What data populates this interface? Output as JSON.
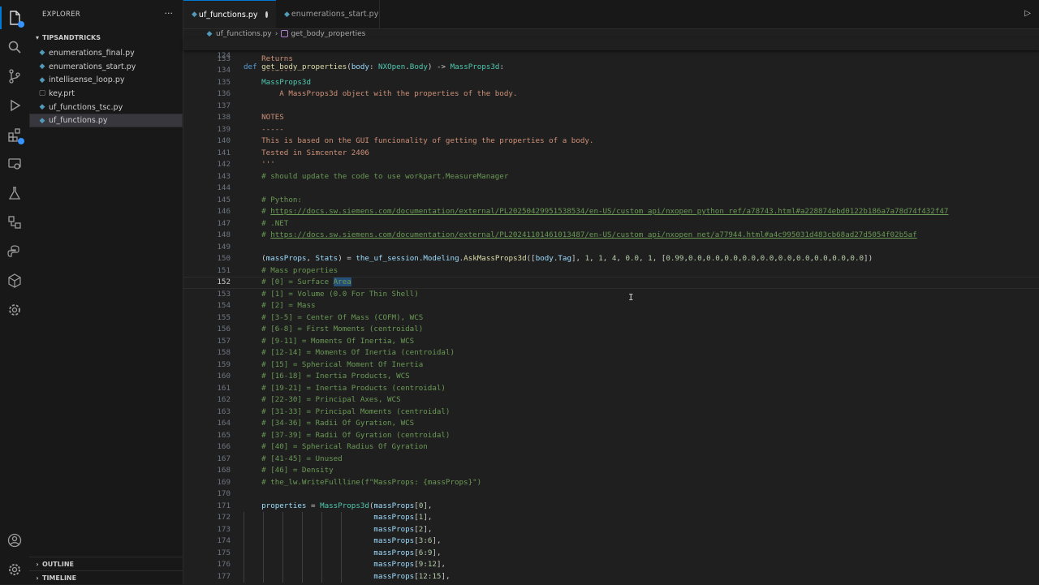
{
  "sidebar": {
    "title": "EXPLORER",
    "more": "···",
    "folder": "TIPSANDTRICKS",
    "files": [
      {
        "name": "enumerations_final.py",
        "type": "py"
      },
      {
        "name": "enumerations_start.py",
        "type": "py"
      },
      {
        "name": "intellisense_loop.py",
        "type": "py"
      },
      {
        "name": "key.prt",
        "type": "other"
      },
      {
        "name": "uf_functions_tsc.py",
        "type": "py"
      },
      {
        "name": "uf_functions.py",
        "type": "py",
        "selected": true
      }
    ],
    "outline": "OUTLINE",
    "timeline": "TIMELINE"
  },
  "tabs": [
    {
      "label": "uf_functions.py",
      "active": true,
      "modified": true
    },
    {
      "label": "enumerations_start.py",
      "active": false
    }
  ],
  "breadcrumb": {
    "file": "uf_functions.py",
    "symbol": "get_body_properties"
  },
  "sticky": {
    "num": "124"
  },
  "lines": [
    {
      "num": "133",
      "text": "    Returns"
    },
    {
      "num": "134",
      "text": "    -------"
    },
    {
      "num": "135",
      "text": "    MassProps3d"
    },
    {
      "num": "136",
      "text": "        A MassProps3d object with the properties of the body."
    },
    {
      "num": "137",
      "text": ""
    },
    {
      "num": "138",
      "text": "    NOTES"
    },
    {
      "num": "139",
      "text": "    -----"
    },
    {
      "num": "140",
      "text": "    This is based on the GUI funcionality of getting the properties of a body."
    },
    {
      "num": "141",
      "text": "    Tested in Simcenter 2406"
    },
    {
      "num": "142",
      "text": "    '''"
    },
    {
      "num": "143",
      "text": "    # should update the code to use workpart.MeasureManager"
    },
    {
      "num": "144",
      "text": ""
    },
    {
      "num": "145",
      "text": "    # Python:"
    },
    {
      "num": "146",
      "text": "    # https://docs.sw.siemens.com/documentation/external/PL20250429951538534/en-US/custom_api/nxopen_python_ref/a78743.html#a228874ebd0122b186a7a78d74f432f47"
    },
    {
      "num": "147",
      "text": "    # .NET"
    },
    {
      "num": "148",
      "text": "    # https://docs.sw.siemens.com/documentation/external/PL20241101461013487/en-US/custom_api/nxopen_net/a77944.html#a4c995031d483cb68ad27d5054f02b5af"
    },
    {
      "num": "149",
      "text": ""
    },
    {
      "num": "150",
      "text": "    (massProps, Stats) = the_uf_session.Modeling.AskMassProps3d([body.Tag], 1, 1, 4, 0.0, 1, [0.99,0.0,0.0,0.0,0.0,0.0,0.0,0.0,0.0,0.0,0.0])"
    },
    {
      "num": "151",
      "text": "    # Mass properties"
    },
    {
      "num": "152",
      "text": "    # [0] = Surface Area"
    },
    {
      "num": "153",
      "text": "    # [1] = Volume (0.0 For Thin Shell)"
    },
    {
      "num": "154",
      "text": "    # [2] = Mass"
    },
    {
      "num": "155",
      "text": "    # [3-5] = Center Of Mass (COFM), WCS"
    },
    {
      "num": "156",
      "text": "    # [6-8] = First Moments (centroidal)"
    },
    {
      "num": "157",
      "text": "    # [9-11] = Moments Of Inertia, WCS"
    },
    {
      "num": "158",
      "text": "    # [12-14] = Moments Of Inertia (centroidal)"
    },
    {
      "num": "159",
      "text": "    # [15] = Spherical Moment Of Inertia"
    },
    {
      "num": "160",
      "text": "    # [16-18] = Inertia Products, WCS"
    },
    {
      "num": "161",
      "text": "    # [19-21] = Inertia Products (centroidal)"
    },
    {
      "num": "162",
      "text": "    # [22-30] = Principal Axes, WCS"
    },
    {
      "num": "163",
      "text": "    # [31-33] = Principal Moments (centroidal)"
    },
    {
      "num": "164",
      "text": "    # [34-36] = Radii Of Gyration, WCS"
    },
    {
      "num": "165",
      "text": "    # [37-39] = Radii Of Gyration (centroidal)"
    },
    {
      "num": "166",
      "text": "    # [40] = Spherical Radius Of Gyration"
    },
    {
      "num": "167",
      "text": "    # [41-45] = Unused"
    },
    {
      "num": "168",
      "text": "    # [46] = Density"
    },
    {
      "num": "169",
      "text": "    # the_lw.WriteFullline(f\"MassProps: {massProps}\")"
    },
    {
      "num": "170",
      "text": ""
    },
    {
      "num": "171",
      "text": "    properties = MassProps3d(massProps[0],"
    },
    {
      "num": "172",
      "text": "                             massProps[1],"
    },
    {
      "num": "173",
      "text": "                             massProps[2],"
    },
    {
      "num": "174",
      "text": "                             massProps[3:6],"
    },
    {
      "num": "175",
      "text": "                             massProps[6:9],"
    },
    {
      "num": "176",
      "text": "                             massProps[9:12],"
    },
    {
      "num": "177",
      "text": "                             massProps[12:15],"
    }
  ],
  "current_line": "152",
  "selected_word": "Area",
  "colors": {
    "accent": "#0078d4",
    "comment": "#6a9955",
    "keyword": "#569cd6",
    "function": "#dcdcaa",
    "type": "#4ec9b0"
  }
}
